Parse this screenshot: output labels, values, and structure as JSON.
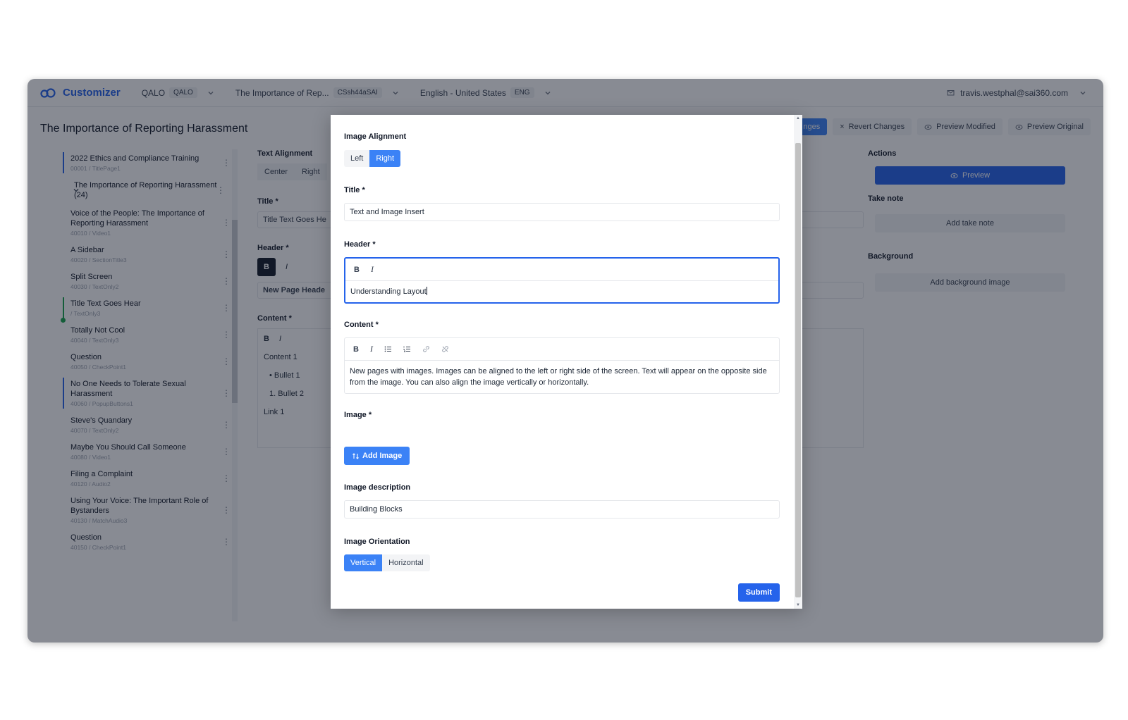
{
  "topbar": {
    "app_name": "Customizer",
    "org_label": "QALO",
    "org_badge": "QALO",
    "course_label": "The Importance of Rep...",
    "course_badge": "CSsh44aSAI",
    "language_label": "English - United States",
    "language_badge": "ENG",
    "user_email": "travis.westphal@sai360.com"
  },
  "page": {
    "title": "The Importance of Reporting Harassment"
  },
  "top_actions": {
    "save_partial": "nges",
    "revert": "Revert Changes",
    "preview_modified": "Preview Modified",
    "preview_original": "Preview Original"
  },
  "sidebar": {
    "items": [
      {
        "title": "2022 Ethics and Compliance Training",
        "sub": "00001 / TitlePage1"
      },
      {
        "title": "The Importance of Reporting Harassment (24)",
        "sub": ""
      },
      {
        "title": "Voice of the People: The Importance of Reporting Harassment",
        "sub": "40010 / Video1"
      },
      {
        "title": "A Sidebar",
        "sub": "40020 / SectionTitle3"
      },
      {
        "title": "Split Screen",
        "sub": "40030 / TextOnly2"
      },
      {
        "title": "Title Text Goes Hear",
        "sub": "/ TextOnly3"
      },
      {
        "title": "Totally Not Cool",
        "sub": "40040 / TextOnly3"
      },
      {
        "title": "Question",
        "sub": "40050 / CheckPoint1"
      },
      {
        "title": "No One Needs to Tolerate Sexual Harassment",
        "sub": "40060 / PopupButtons1"
      },
      {
        "title": "Steve's Quandary",
        "sub": "40070 / TextOnly2"
      },
      {
        "title": "Maybe You Should Call Someone",
        "sub": "40080 / Video1"
      },
      {
        "title": "Filing a Complaint",
        "sub": "40120 / Audio2"
      },
      {
        "title": "Using Your Voice: The Important Role of Bystanders",
        "sub": "40130 / MatchAudio3"
      },
      {
        "title": "Question",
        "sub": "40150 / CheckPoint1"
      }
    ]
  },
  "editor": {
    "text_alignment_label": "Text Alignment",
    "align_center": "Center",
    "align_right": "Right",
    "title_label": "Title *",
    "title_value": "Title Text Goes He",
    "header_label": "Header *",
    "header_value": "New Page Heade",
    "content_label": "Content *",
    "content_line1": "Content 1",
    "bullet1": "Bullet 1",
    "bullet2": "Bullet 2",
    "link1": "Link 1",
    "num1": "1.",
    "bullet_mark": "•"
  },
  "right_panel": {
    "actions_label": "Actions",
    "preview_button": "Preview",
    "take_note_label": "Take note",
    "add_take_note": "Add take note",
    "background_label": "Background",
    "add_background_image": "Add background image"
  },
  "modal": {
    "image_alignment_label": "Image Alignment",
    "align_left": "Left",
    "align_right": "Right",
    "title_label": "Title *",
    "title_value": "Text and Image Insert",
    "header_label": "Header *",
    "header_value": "Understanding Layout",
    "content_label": "Content *",
    "content_value": "New pages with images. Images can be aligned to the left or right side of the screen. Text will appear on the opposite side from the image. You can also align the image vertically or horizontally.",
    "image_label": "Image *",
    "add_image_button": "Add Image",
    "image_description_label": "Image description",
    "image_description_value": "Building Blocks",
    "image_orientation_label": "Image Orientation",
    "orient_vertical": "Vertical",
    "orient_horizontal": "Horizontal",
    "submit_button": "Submit",
    "bold_glyph": "B",
    "italic_glyph": "I"
  },
  "colors": {
    "primary": "#3b82f6",
    "primary_dark": "#2563eb",
    "active_green": "#16a34a",
    "overlay": "#111827"
  }
}
